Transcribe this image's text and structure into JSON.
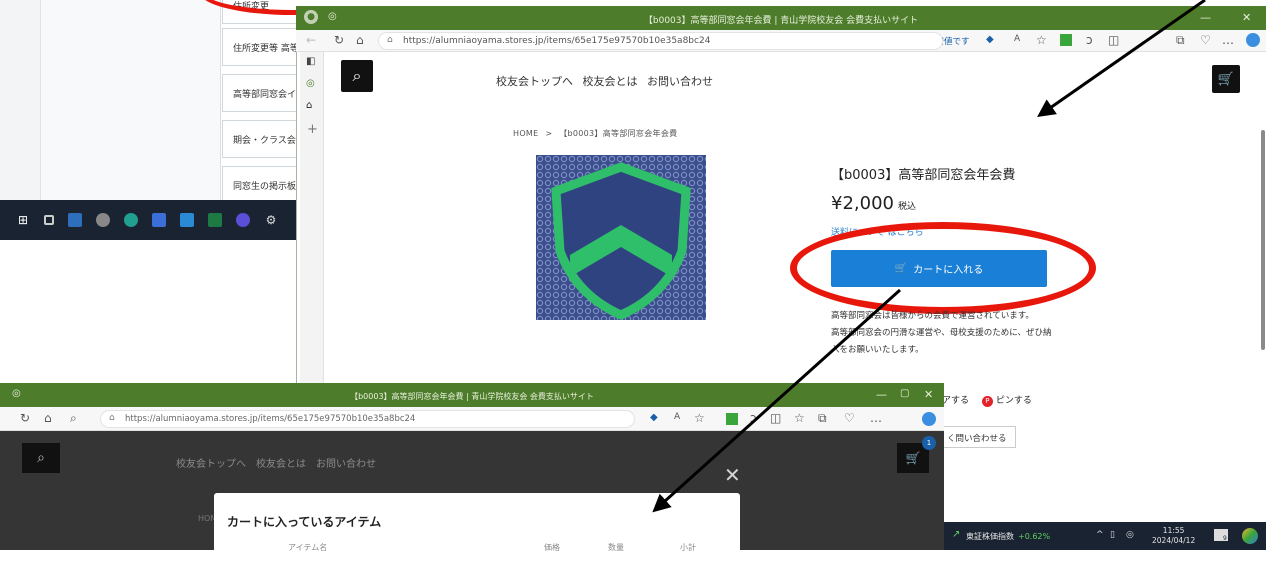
{
  "back_window": {
    "menu_items": [
      "住所変更",
      "住所変更等 高等",
      "高等部同窓会イ",
      "期会・クラス会・O",
      "同窓生の掲示板("
    ]
  },
  "main_window": {
    "title": "【b0003】高等部同窓会年会費 | 青山学院校友会 会費支払いサイト",
    "url": "https://alumniaoyama.stores.jp/items/65e175e97570b10e35a8bc24",
    "cheapest_label": "最安値です",
    "nav": [
      "校友会トップへ",
      "校友会とは",
      "お問い合わせ"
    ],
    "breadcrumb_home": "HOME",
    "breadcrumb_sep": ">",
    "breadcrumb_item": "【b0003】高等部同窓会年会費",
    "product_title": "【b0003】高等部同窓会年会費",
    "price": "¥2,000",
    "tax_label": "税込",
    "shipping_link": "送料について はこちら",
    "add_to_cart": "カートに入れる",
    "description_lines": [
      "高等部同窓会は皆様からの会費で運営されています。",
      "高等部同窓会の円滑な運営や、母校支援のために、ぜひ納",
      "入をお願いいたします。"
    ],
    "share_label": "アする",
    "pin_label": "ピンする",
    "inquiry_label": "く問い合わせる"
  },
  "front_window": {
    "title": "【b0003】高等部同窓会年会費 | 青山学院校友会 会費支払いサイト",
    "url": "https://alumniaoyama.stores.jp/items/65e175e97570b10e35a8bc24",
    "nav": "校友会トップへ　校友会とは　お問い合わせ",
    "breadcrumb_home": "HOM",
    "cart_badge": "1",
    "modal_title": "カートに入っているアイテム",
    "cols": [
      "アイテム名",
      "価格",
      "数量",
      "小計"
    ]
  },
  "taskbar": {
    "ticker_label": "東証株価指数",
    "ticker_change": "+0.62%",
    "time": "11:55",
    "date": "2024/04/12",
    "notif_count": "9"
  },
  "colors": {
    "title_green": "#4d7d2a",
    "cart_blue": "#1a7fd6",
    "annotation_red": "#e8170c"
  }
}
